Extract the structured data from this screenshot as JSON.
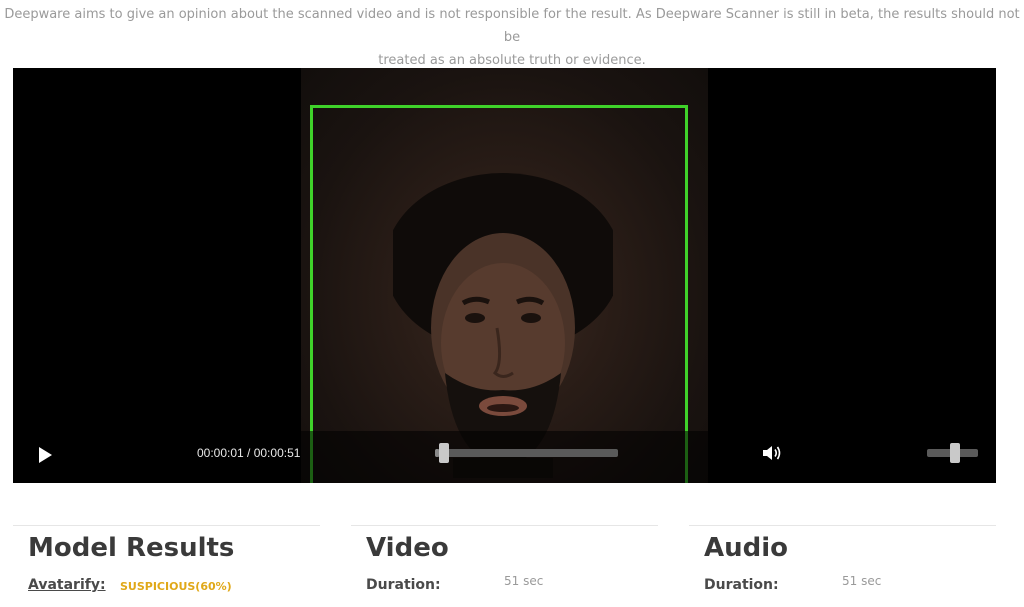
{
  "disclaimer": {
    "line1": "Deepware aims to give an opinion about the scanned video and is not responsible for the result. As Deepware Scanner is still in beta, the results should not be",
    "line2": "treated as an absolute truth or evidence."
  },
  "player": {
    "current_time": "00:00:01",
    "duration": "00:00:51",
    "time_display": "00:00:01 / 00:00:51",
    "progress": 0.02,
    "volume": 0.55,
    "detection_color": "#3fd22a",
    "icons": {
      "play": "play-icon",
      "volume": "volume-icon"
    }
  },
  "model_results": {
    "title": "Model Results",
    "model_name": "Avatarify:",
    "status": "SUSPICIOUS(60%)",
    "status_color": "#e0a818"
  },
  "video": {
    "title": "Video",
    "duration_label": "Duration:",
    "duration_value": "51 sec"
  },
  "audio": {
    "title": "Audio",
    "duration_label": "Duration:",
    "duration_value": "51 sec"
  }
}
